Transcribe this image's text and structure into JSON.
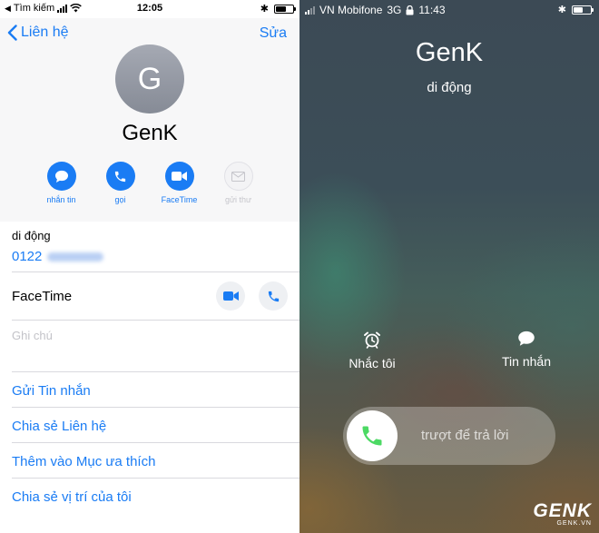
{
  "left_status": {
    "back_app": "Tìm kiếm",
    "time": "12:05",
    "battery_level": 0.6
  },
  "contact": {
    "nav_back_label": "Liên hệ",
    "edit_label": "Sửa",
    "avatar_initial": "G",
    "name": "GenK",
    "actions": [
      {
        "label": "nhắn tin",
        "icon": "message-icon",
        "enabled": true
      },
      {
        "label": "gọi",
        "icon": "phone-icon",
        "enabled": true
      },
      {
        "label": "FaceTime",
        "icon": "video-icon",
        "enabled": true
      },
      {
        "label": "gửi thư",
        "icon": "mail-icon",
        "enabled": false
      }
    ],
    "phone_label": "di động",
    "phone_number_prefix": "0122",
    "facetime_label": "FaceTime",
    "notes_placeholder": "Ghi chú",
    "links": [
      "Gửi Tin nhắn",
      "Chia sẻ Liên hệ",
      "Thêm vào Mục ưa thích",
      "Chia sẻ vị trí của tôi"
    ]
  },
  "right_status": {
    "carrier": "VN Mobifone",
    "network": "3G",
    "time": "11:43",
    "battery_level": 0.55
  },
  "call": {
    "caller_name": "GenK",
    "caller_type": "di động",
    "remind_label": "Nhắc tôi",
    "message_label": "Tin nhắn",
    "slide_text": "trượt để trả lời"
  },
  "watermark": {
    "main": "GENK",
    "sub": "GENK.VN"
  },
  "colors": {
    "accent": "#1a7cf4",
    "answer_green": "#4cd964"
  }
}
